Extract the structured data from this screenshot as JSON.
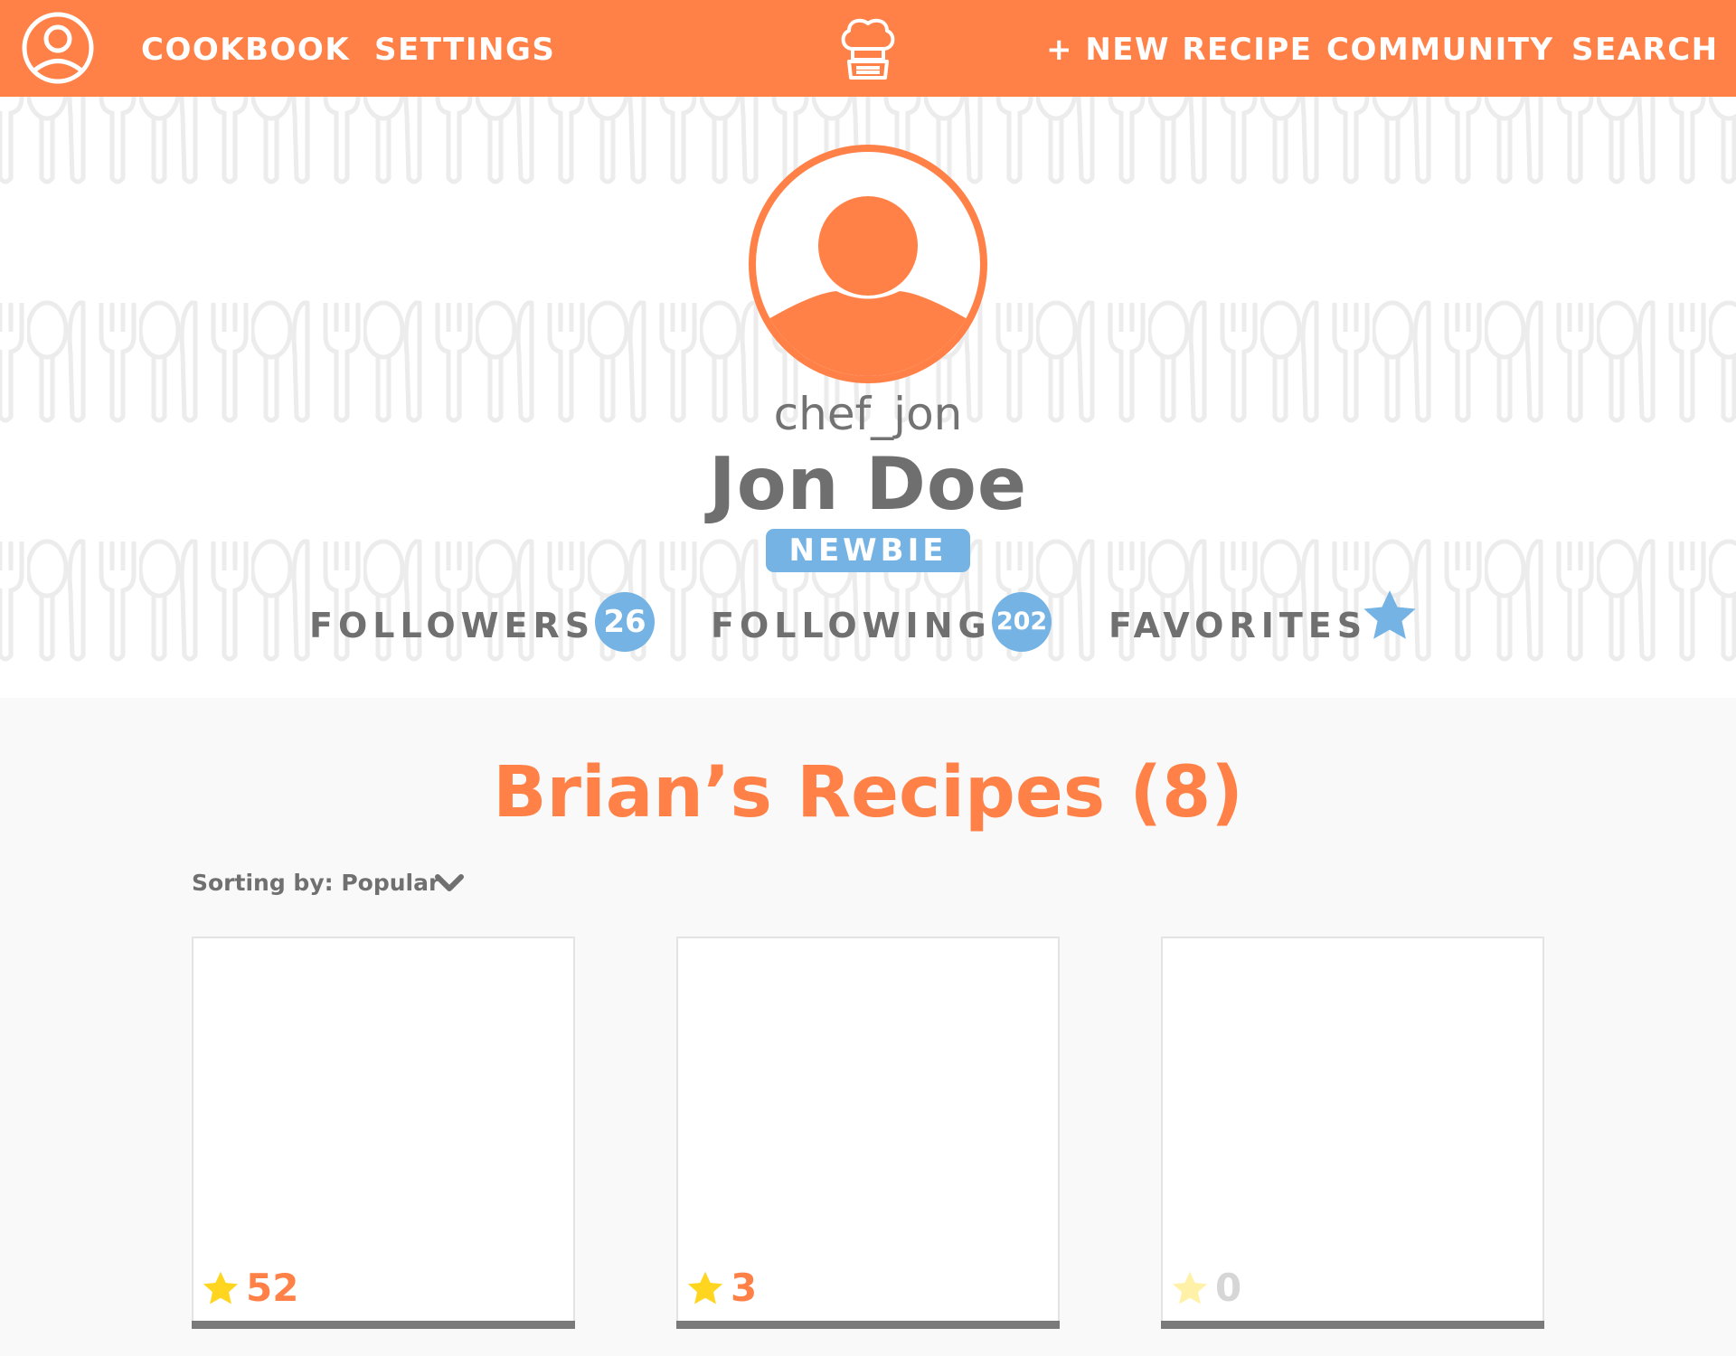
{
  "nav": {
    "cookbook": "COOKBOOK",
    "settings": "SETTINGS",
    "new_recipe": "+ NEW RECIPE",
    "community": "COMMUNITY",
    "search": "SEARCH"
  },
  "profile": {
    "username": "chef_jon",
    "full_name": "Jon Doe",
    "badge": "NEWBIE",
    "stats": {
      "followers_label": "FOLLOWERS",
      "followers_count": "26",
      "following_label": "FOLLOWING",
      "following_count": "202",
      "favorites_label": "FAVORITES"
    }
  },
  "recipes": {
    "title": "Brian’s Recipes (8)",
    "sort_label": "Sorting by: Popular",
    "cards": [
      {
        "rating": "52"
      },
      {
        "rating": "3"
      },
      {
        "rating": "0"
      }
    ]
  },
  "colors": {
    "brand": "#ff8147",
    "accent_blue": "#74b3e3",
    "text_gray": "#707070",
    "star_yellow": "#ffd51f"
  },
  "icons": {
    "user": "user-circle-icon",
    "logo": "chef-hat-logo-icon",
    "favorites": "star-icon",
    "sort": "chevron-down-icon"
  }
}
